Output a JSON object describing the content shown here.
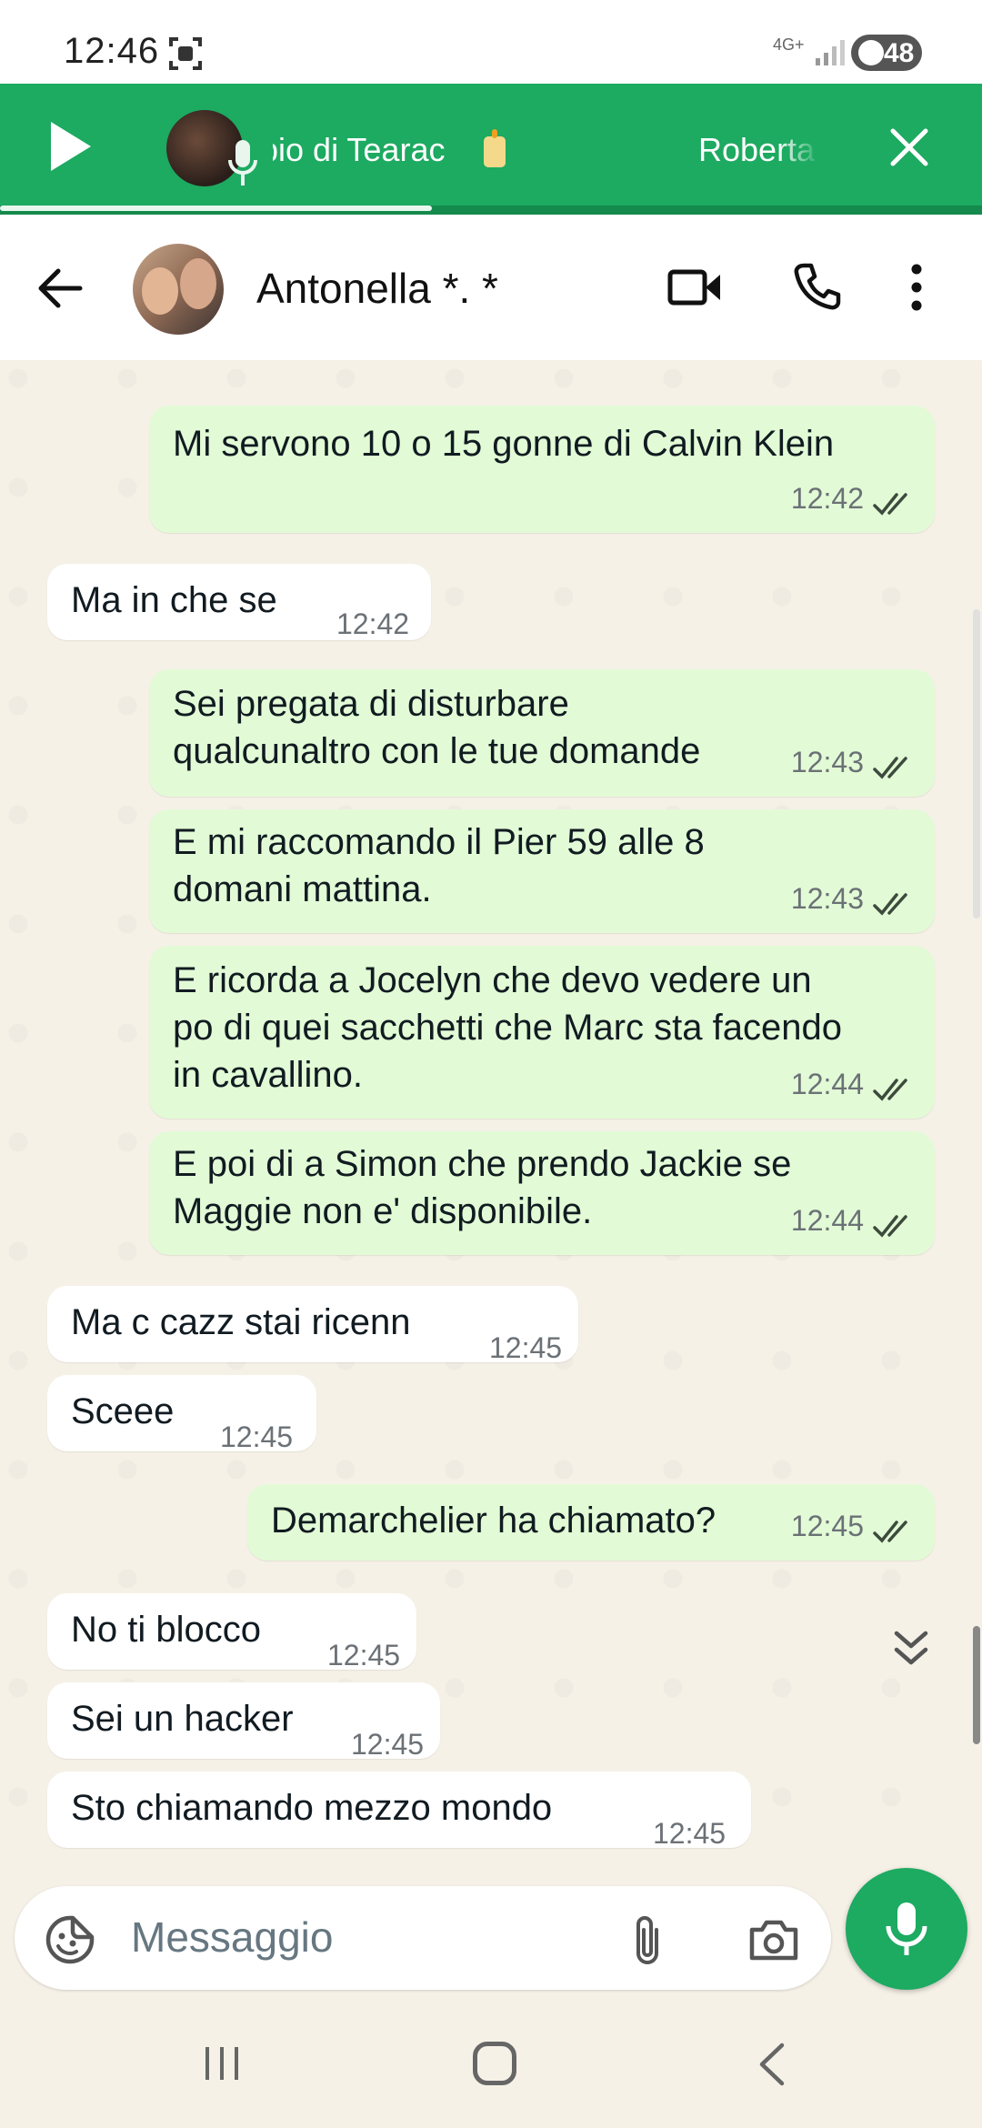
{
  "status_bar": {
    "time": "12:46",
    "network": "4G+",
    "battery": "48"
  },
  "banner": {
    "title": "pio di Tearac",
    "subtitle": "Roberta",
    "progress": 0.44
  },
  "header": {
    "contact_name": "Antonella *. *"
  },
  "messages": [
    {
      "dir": "out",
      "text": "Mi servono 10 o 15 gonne di Calvin Klein",
      "time": "12:42"
    },
    {
      "dir": "in",
      "text": "Ma in che se",
      "time": "12:42"
    },
    {
      "dir": "out",
      "text": "Sei pregata di disturbare qualcunaltro con le tue domande",
      "time": "12:43"
    },
    {
      "dir": "out",
      "text": "E mi raccomando il Pier 59 alle 8 domani mattina.",
      "time": "12:43"
    },
    {
      "dir": "out",
      "text": "E ricorda a Jocelyn che devo vedere un po di quei sacchetti che Marc sta facendo in cavallino.",
      "time": "12:44"
    },
    {
      "dir": "out",
      "text": "E poi di a Simon che prendo Jackie se Maggie non e' disponibile.",
      "time": "12:44"
    },
    {
      "dir": "in",
      "text": "Ma c cazz stai ricenn",
      "time": "12:45"
    },
    {
      "dir": "in",
      "text": "Sceee",
      "time": "12:45"
    },
    {
      "dir": "out",
      "text": "Demarchelier ha chiamato?",
      "time": "12:45"
    },
    {
      "dir": "in",
      "text": "No ti blocco",
      "time": "12:45"
    },
    {
      "dir": "in",
      "text": "Sei un hacker",
      "time": "12:45"
    },
    {
      "dir": "in",
      "text": "Sto chiamando mezzo mondo",
      "time": "12:45"
    }
  ],
  "composer": {
    "placeholder": "Messaggio"
  },
  "colors": {
    "brand_green": "#1daa61",
    "outgoing_bubble": "#e2fbd6",
    "chat_background": "#f6f1e7",
    "read_ticks": "#3d4a3d"
  }
}
